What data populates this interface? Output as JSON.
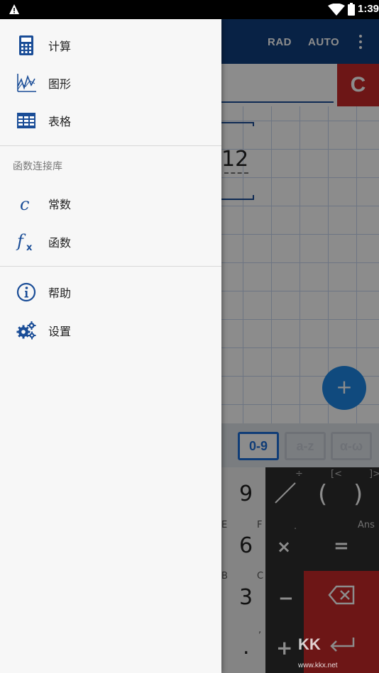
{
  "status_bar": {
    "time": "1:39"
  },
  "app_bar": {
    "angle_mode": "RAD",
    "format_mode": "AUTO"
  },
  "input": {
    "clear_label": "C"
  },
  "result": {
    "value": "12"
  },
  "fab": {
    "label": "+"
  },
  "keyboard_modes": [
    "0-9",
    "a-z",
    "α-ω"
  ],
  "keypad": {
    "digits": [
      "9",
      "6",
      "3",
      "."
    ],
    "digit_hints": [
      "E",
      "F",
      "B",
      "C",
      ","
    ],
    "ops": [
      "(",
      ")",
      "×",
      "=",
      "−",
      "+"
    ],
    "op_hints": [
      "÷",
      "[<",
      "]>",
      ".",
      "Ans"
    ]
  },
  "drawer": {
    "items": [
      {
        "label": "计算",
        "icon": "calculator-icon"
      },
      {
        "label": "图形",
        "icon": "graph-icon"
      },
      {
        "label": "表格",
        "icon": "table-icon"
      }
    ],
    "library_title": "函数连接库",
    "library_items": [
      {
        "label": "常数",
        "icon": "constant-icon"
      },
      {
        "label": "函数",
        "icon": "function-icon"
      }
    ],
    "bottom_items": [
      {
        "label": "帮助",
        "icon": "info-icon"
      },
      {
        "label": "设置",
        "icon": "settings-icon"
      }
    ]
  },
  "watermark": {
    "brand": "KK",
    "url": "www.kkx.net"
  },
  "colors": {
    "primary": "#0f3e7e",
    "accent": "#1e88e5",
    "clear": "#c62828",
    "drawer_icon": "#1a4d97"
  }
}
